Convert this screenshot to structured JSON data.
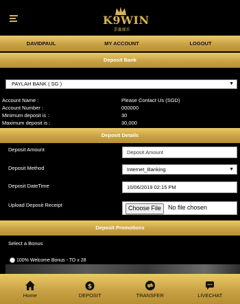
{
  "header": {
    "logo_text": "K9WIN",
    "logo_sub": "京赢娱乐"
  },
  "user_nav": {
    "username": "DAVIDPAUL",
    "my_account": "MY ACCOUNT",
    "logout": "LOGOUT"
  },
  "deposit_bank": {
    "title": "Deposit Bank",
    "selected_bank": "PAYLAH BANK ( SG )",
    "account_name_label": "Account Name :",
    "account_name_value": "Please Contact Us (SGD)",
    "account_number_label": "Account Number :",
    "account_number_value": "000000",
    "min_deposit_label": "Minimum deposit is :",
    "min_deposit_value": "30",
    "max_deposit_label": "Maximum deposit is :",
    "max_deposit_value": "30,000"
  },
  "deposit_details": {
    "title": "Deposit Details",
    "amount_label": "Deposit Amount",
    "amount_placeholder": "Deposit Amount",
    "method_label": "Deposit Method",
    "method_value": "Internet_Banking",
    "datetime_label": "Deposit DateTime",
    "datetime_value": "10/06/2019 02:15 PM",
    "receipt_label": "Upload Deposit Receipt",
    "file_button": "Choose File",
    "file_status": "No file chosen"
  },
  "promotions": {
    "title": "Deposit Promotions",
    "select_label": "Select a Bonus",
    "bonus_option": "100% Welcome Bonus - TO x 28"
  },
  "bottom_nav": {
    "home": "Home",
    "deposit": "DEPOSIT",
    "transfer": "TRANSFER",
    "livechat": "LIVECHAT"
  },
  "colors": {
    "gold": "#c9a245",
    "background": "#000000"
  }
}
